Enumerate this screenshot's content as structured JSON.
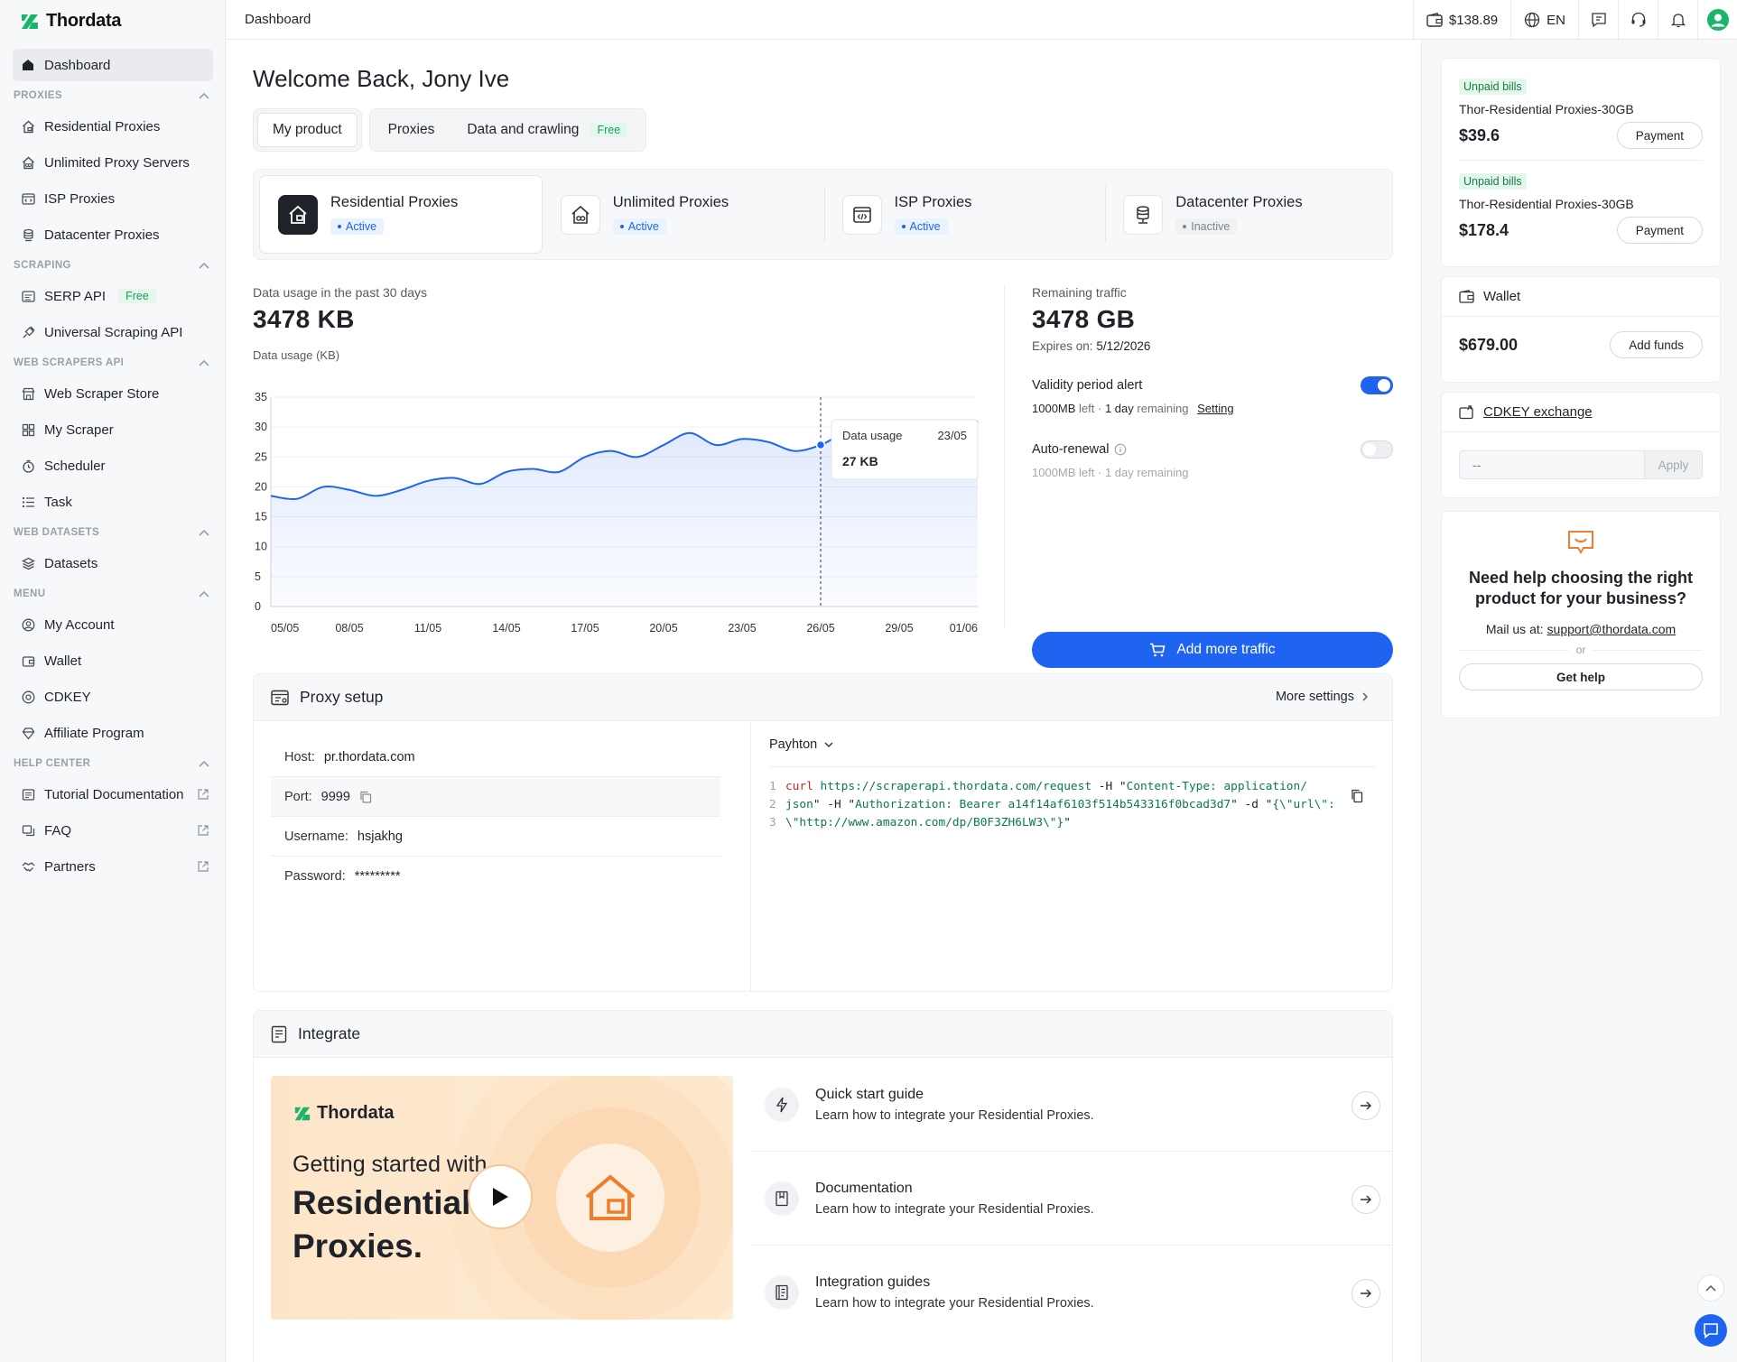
{
  "brand": {
    "name": "Thordata",
    "accent": "#1e64f0",
    "logo_green": "#19b56c"
  },
  "topbar": {
    "breadcrumb": "Dashboard",
    "balance": "$138.89",
    "language": "EN"
  },
  "sidebar": {
    "dashboard": "Dashboard",
    "sections": {
      "proxies": "PROXIES",
      "scraping": "SCRAPING",
      "web_scrapers": "WEB SCRAPERS API",
      "web_datasets": "WEB DATASETS",
      "menu": "MENU",
      "help": "HELP CENTER"
    },
    "proxies": [
      "Residential Proxies",
      "Unlimited Proxy Servers",
      "ISP Proxies",
      "Datacenter Proxies"
    ],
    "scraping": [
      "SERP API",
      "Universal Scraping API"
    ],
    "free_badge": "Free",
    "web_scrapers": [
      "Web Scraper Store",
      "My Scraper",
      "Scheduler",
      "Task"
    ],
    "web_datasets": [
      "Datasets"
    ],
    "menu": [
      "My Account",
      "Wallet",
      "CDKEY",
      "Affiliate Program"
    ],
    "help": [
      "Tutorial Documentation",
      "FAQ",
      "Partners"
    ]
  },
  "main": {
    "welcome": "Welcome Back, Jony Ive",
    "tabs": {
      "my_product": "My product",
      "proxies": "Proxies",
      "data_crawling": "Data and crawling",
      "free": "Free"
    },
    "products": [
      {
        "name": "Residential Proxies",
        "status": "Active"
      },
      {
        "name": "Unlimited Proxies",
        "status": "Active"
      },
      {
        "name": "ISP Proxies",
        "status": "Active"
      },
      {
        "name": "Datacenter Proxies",
        "status": "Inactive"
      }
    ],
    "usage": {
      "label": "Data usage in the past 30 days",
      "value": "3478 KB",
      "chart_label": "Data usage (KB)",
      "tooltip_label": "Data usage",
      "tooltip_date": "23/05",
      "tooltip_value": "27 KB"
    },
    "remaining": {
      "label": "Remaining traffic",
      "value": "3478 GB",
      "expires_label": "Expires on:",
      "expires_date": "5/12/2026",
      "validity_title": "Validity period alert",
      "validity_on": true,
      "amount": "1000MB",
      "left": "left ·",
      "days": "1 day",
      "remaining_word": "remaining",
      "setting": "Setting",
      "autorenew_title": "Auto-renewal",
      "autorenew_on": false,
      "add_traffic": "Add more traffic"
    },
    "setup": {
      "title": "Proxy setup",
      "more": "More settings",
      "host_label": "Host:",
      "host": "pr.thordata.com",
      "port_label": "Port:",
      "port": "9999",
      "user_label": "Username:",
      "user": "hsjakhg",
      "pass_label": "Password:",
      "pass": "*********",
      "language": "Payhton",
      "code": {
        "l1_cmd": "curl",
        "l1_url": "https://scraperapi.thordata.com/request",
        "l1_flag": "-H",
        "l1_q": "\"",
        "l1_hdr": "Content-Type: application/",
        "l2_hdr_end": "json",
        "l2_mid": "\" -H \"",
        "l2_auth": "Authorization: Bearer a14f14af6103f514b543316f0bcad3d7",
        "l2_d": "\" -d \"",
        "l2_json": "{\\\"url\\\":",
        "l3_url": "\\\"http://www.amazon.com/dp/B0F3ZH6LW3\\\"}",
        "l3_end": "\""
      }
    },
    "integrate": {
      "title": "Integrate",
      "video_brand": "Thordata",
      "video_line1": "Getting started with",
      "video_line2": "Residential",
      "video_line3": "Proxies.",
      "items": [
        {
          "title": "Quick start guide",
          "sub": "Learn how to integrate your Residential Proxies.",
          "icon": "bolt-icon"
        },
        {
          "title": "Documentation",
          "sub": "Learn how to integrate your Residential Proxies.",
          "icon": "book-icon"
        },
        {
          "title": "Integration guides",
          "sub": "Learn how to integrate your Residential Proxies.",
          "icon": "guide-icon"
        }
      ]
    }
  },
  "right": {
    "bills": [
      {
        "tag": "Unpaid bills",
        "name": "Thor-Residential Proxies-30GB",
        "price": "$39.6",
        "button": "Payment"
      },
      {
        "tag": "Unpaid bills",
        "name": "Thor-Residential Proxies-30GB",
        "price": "$178.4",
        "button": "Payment"
      }
    ],
    "wallet": {
      "title": "Wallet",
      "amount": "$679.00",
      "button": "Add funds"
    },
    "cdkey": {
      "title": "CDKEY exchange",
      "placeholder": "--",
      "button": "Apply"
    },
    "help": {
      "title": "Need help choosing the right product for your business?",
      "mail_label": "Mail us at:",
      "email": "support@thordata.com",
      "or": "or",
      "button": "Get help"
    }
  },
  "chart_data": {
    "type": "area",
    "title": "",
    "ylabel": "Data usage (KB)",
    "ylim": [
      0,
      35
    ],
    "yticks": [
      0,
      5,
      10,
      15,
      20,
      25,
      30,
      35
    ],
    "xticks": [
      "05/05",
      "08/05",
      "11/05",
      "14/05",
      "17/05",
      "20/05",
      "23/05",
      "26/05",
      "29/05",
      "01/06"
    ],
    "x": [
      "05/05",
      "06/05",
      "07/05",
      "08/05",
      "09/05",
      "10/05",
      "11/05",
      "12/05",
      "13/05",
      "14/05",
      "15/05",
      "16/05",
      "17/05",
      "18/05",
      "19/05",
      "20/05",
      "21/05",
      "22/05",
      "23/05",
      "24/05",
      "25/05",
      "26/05",
      "27/05",
      "28/05",
      "29/05",
      "30/05",
      "31/05",
      "01/06"
    ],
    "series": [
      {
        "values": [
          18.5,
          18,
          20,
          19.5,
          18.5,
          19.5,
          21,
          21.5,
          20.5,
          22.5,
          23,
          22.5,
          25,
          26,
          25,
          27,
          29,
          27,
          28,
          27.5,
          26,
          27,
          29,
          27.5,
          28.5,
          27,
          28,
          31
        ]
      }
    ],
    "highlight": {
      "x": "26/05",
      "value": 27
    },
    "grid": true,
    "color": "#1e64f0"
  }
}
